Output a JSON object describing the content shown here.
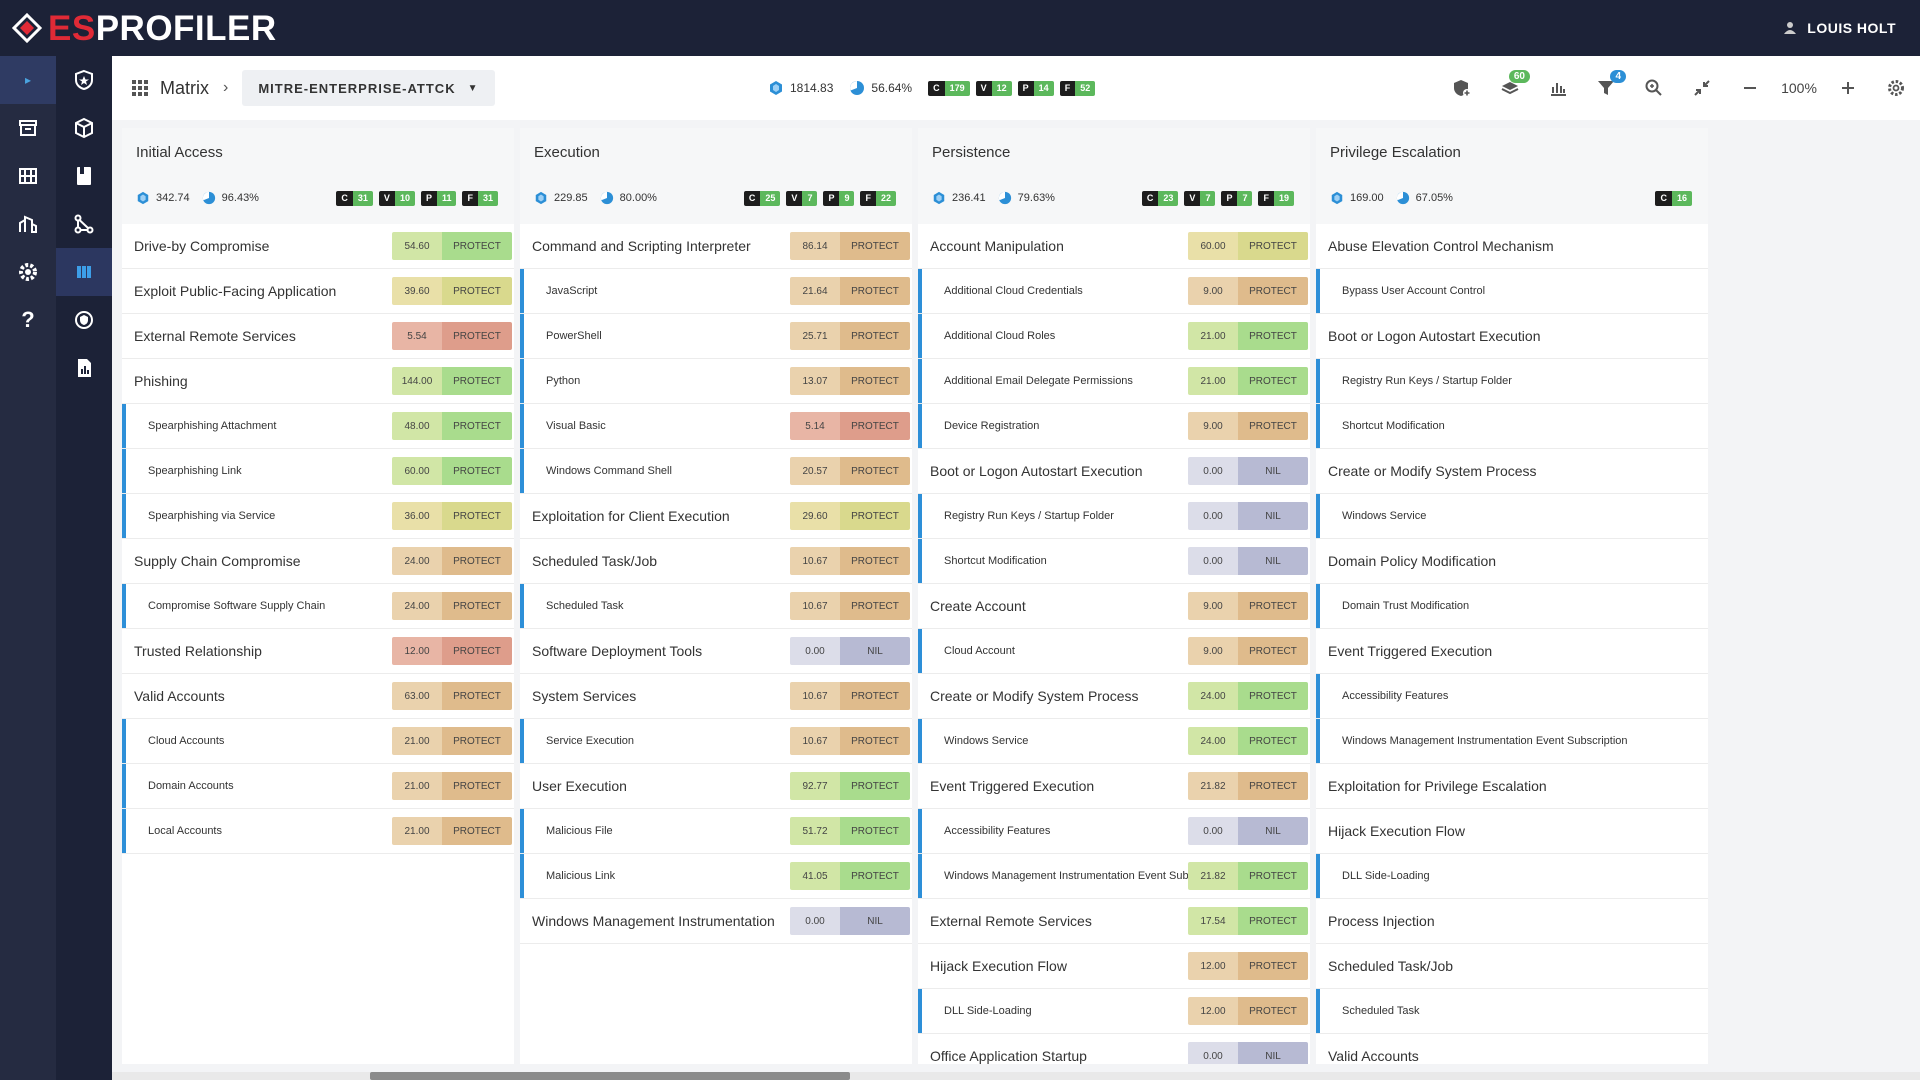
{
  "app": {
    "brand_es": "ES",
    "brand_rest": "PROFILER",
    "user": "LOUIS HOLT"
  },
  "toolbar": {
    "crumb": "Matrix",
    "dropdown": "MITRE-ENTERPRISE-ATTCK",
    "score": "1814.83",
    "pct": "56.64%",
    "badges": [
      {
        "k": "C",
        "v": "179"
      },
      {
        "k": "V",
        "v": "12"
      },
      {
        "k": "P",
        "v": "14"
      },
      {
        "k": "F",
        "v": "52"
      }
    ],
    "filter_count": "60",
    "funnel_count": "4",
    "zoom": "100%"
  },
  "columns": [
    {
      "title": "Initial Access",
      "score": "342.74",
      "pct": "96.43%",
      "badges": [
        {
          "k": "C",
          "v": "31"
        },
        {
          "k": "V",
          "v": "10"
        },
        {
          "k": "P",
          "v": "11"
        },
        {
          "k": "F",
          "v": "31"
        }
      ],
      "rows": [
        {
          "name": "Drive-by Compromise",
          "score": "54.60",
          "label": "PROTECT",
          "color": "g",
          "sub": false
        },
        {
          "name": "Exploit Public-Facing Application",
          "score": "39.60",
          "label": "PROTECT",
          "color": "y",
          "sub": false
        },
        {
          "name": "External Remote Services",
          "score": "5.54",
          "label": "PROTECT",
          "color": "r",
          "sub": false
        },
        {
          "name": "Phishing",
          "score": "144.00",
          "label": "PROTECT",
          "color": "g",
          "sub": false
        },
        {
          "name": "Spearphishing Attachment",
          "score": "48.00",
          "label": "PROTECT",
          "color": "g",
          "sub": true
        },
        {
          "name": "Spearphishing Link",
          "score": "60.00",
          "label": "PROTECT",
          "color": "g",
          "sub": true
        },
        {
          "name": "Spearphishing via Service",
          "score": "36.00",
          "label": "PROTECT",
          "color": "y",
          "sub": true
        },
        {
          "name": "Supply Chain Compromise",
          "score": "24.00",
          "label": "PROTECT",
          "color": "o",
          "sub": false
        },
        {
          "name": "Compromise Software Supply Chain",
          "score": "24.00",
          "label": "PROTECT",
          "color": "o",
          "sub": true
        },
        {
          "name": "Trusted Relationship",
          "score": "12.00",
          "label": "PROTECT",
          "color": "r",
          "sub": false
        },
        {
          "name": "Valid Accounts",
          "score": "63.00",
          "label": "PROTECT",
          "color": "o",
          "sub": false
        },
        {
          "name": "Cloud Accounts",
          "score": "21.00",
          "label": "PROTECT",
          "color": "o",
          "sub": true
        },
        {
          "name": "Domain Accounts",
          "score": "21.00",
          "label": "PROTECT",
          "color": "o",
          "sub": true
        },
        {
          "name": "Local Accounts",
          "score": "21.00",
          "label": "PROTECT",
          "color": "o",
          "sub": true
        }
      ]
    },
    {
      "title": "Execution",
      "score": "229.85",
      "pct": "80.00%",
      "badges": [
        {
          "k": "C",
          "v": "25"
        },
        {
          "k": "V",
          "v": "7"
        },
        {
          "k": "P",
          "v": "9"
        },
        {
          "k": "F",
          "v": "22"
        }
      ],
      "rows": [
        {
          "name": "Command and Scripting Interpreter",
          "score": "86.14",
          "label": "PROTECT",
          "color": "o",
          "sub": false
        },
        {
          "name": "JavaScript",
          "score": "21.64",
          "label": "PROTECT",
          "color": "o",
          "sub": true
        },
        {
          "name": "PowerShell",
          "score": "25.71",
          "label": "PROTECT",
          "color": "o",
          "sub": true
        },
        {
          "name": "Python",
          "score": "13.07",
          "label": "PROTECT",
          "color": "o",
          "sub": true
        },
        {
          "name": "Visual Basic",
          "score": "5.14",
          "label": "PROTECT",
          "color": "r",
          "sub": true
        },
        {
          "name": "Windows Command Shell",
          "score": "20.57",
          "label": "PROTECT",
          "color": "o",
          "sub": true
        },
        {
          "name": "Exploitation for Client Execution",
          "score": "29.60",
          "label": "PROTECT",
          "color": "y",
          "sub": false
        },
        {
          "name": "Scheduled Task/Job",
          "score": "10.67",
          "label": "PROTECT",
          "color": "o",
          "sub": false
        },
        {
          "name": "Scheduled Task",
          "score": "10.67",
          "label": "PROTECT",
          "color": "o",
          "sub": true
        },
        {
          "name": "Software Deployment Tools",
          "score": "0.00",
          "label": "NIL",
          "color": "n",
          "sub": false
        },
        {
          "name": "System Services",
          "score": "10.67",
          "label": "PROTECT",
          "color": "o",
          "sub": false
        },
        {
          "name": "Service Execution",
          "score": "10.67",
          "label": "PROTECT",
          "color": "o",
          "sub": true
        },
        {
          "name": "User Execution",
          "score": "92.77",
          "label": "PROTECT",
          "color": "g",
          "sub": false
        },
        {
          "name": "Malicious File",
          "score": "51.72",
          "label": "PROTECT",
          "color": "g",
          "sub": true
        },
        {
          "name": "Malicious Link",
          "score": "41.05",
          "label": "PROTECT",
          "color": "g",
          "sub": true
        },
        {
          "name": "Windows Management Instrumentation",
          "score": "0.00",
          "label": "NIL",
          "color": "n",
          "sub": false
        }
      ]
    },
    {
      "title": "Persistence",
      "score": "236.41",
      "pct": "79.63%",
      "badges": [
        {
          "k": "C",
          "v": "23"
        },
        {
          "k": "V",
          "v": "7"
        },
        {
          "k": "P",
          "v": "7"
        },
        {
          "k": "F",
          "v": "19"
        }
      ],
      "rows": [
        {
          "name": "Account Manipulation",
          "score": "60.00",
          "label": "PROTECT",
          "color": "y",
          "sub": false
        },
        {
          "name": "Additional Cloud Credentials",
          "score": "9.00",
          "label": "PROTECT",
          "color": "o",
          "sub": true
        },
        {
          "name": "Additional Cloud Roles",
          "score": "21.00",
          "label": "PROTECT",
          "color": "g",
          "sub": true
        },
        {
          "name": "Additional Email Delegate Permissions",
          "score": "21.00",
          "label": "PROTECT",
          "color": "g",
          "sub": true
        },
        {
          "name": "Device Registration",
          "score": "9.00",
          "label": "PROTECT",
          "color": "o",
          "sub": true
        },
        {
          "name": "Boot or Logon Autostart Execution",
          "score": "0.00",
          "label": "NIL",
          "color": "n",
          "sub": false
        },
        {
          "name": "Registry Run Keys / Startup Folder",
          "score": "0.00",
          "label": "NIL",
          "color": "n",
          "sub": true
        },
        {
          "name": "Shortcut Modification",
          "score": "0.00",
          "label": "NIL",
          "color": "n",
          "sub": true
        },
        {
          "name": "Create Account",
          "score": "9.00",
          "label": "PROTECT",
          "color": "o",
          "sub": false
        },
        {
          "name": "Cloud Account",
          "score": "9.00",
          "label": "PROTECT",
          "color": "o",
          "sub": true
        },
        {
          "name": "Create or Modify System Process",
          "score": "24.00",
          "label": "PROTECT",
          "color": "g",
          "sub": false
        },
        {
          "name": "Windows Service",
          "score": "24.00",
          "label": "PROTECT",
          "color": "g",
          "sub": true
        },
        {
          "name": "Event Triggered Execution",
          "score": "21.82",
          "label": "PROTECT",
          "color": "o",
          "sub": false
        },
        {
          "name": "Accessibility Features",
          "score": "0.00",
          "label": "NIL",
          "color": "n",
          "sub": true
        },
        {
          "name": "Windows Management Instrumentation Event Subscription",
          "score": "21.82",
          "label": "PROTECT",
          "color": "g",
          "sub": true
        },
        {
          "name": "External Remote Services",
          "score": "17.54",
          "label": "PROTECT",
          "color": "g",
          "sub": false
        },
        {
          "name": "Hijack Execution Flow",
          "score": "12.00",
          "label": "PROTECT",
          "color": "o",
          "sub": false
        },
        {
          "name": "DLL Side-Loading",
          "score": "12.00",
          "label": "PROTECT",
          "color": "o",
          "sub": true
        },
        {
          "name": "Office Application Startup",
          "score": "0.00",
          "label": "NIL",
          "color": "n",
          "sub": false
        }
      ]
    },
    {
      "title": "Privilege Escalation",
      "score": "169.00",
      "pct": "67.05%",
      "badges": [
        {
          "k": "C",
          "v": "16"
        }
      ],
      "rows": [
        {
          "name": "Abuse Elevation Control Mechanism",
          "score": "",
          "label": "",
          "color": "",
          "sub": false
        },
        {
          "name": "Bypass User Account Control",
          "score": "",
          "label": "",
          "color": "",
          "sub": true
        },
        {
          "name": "Boot or Logon Autostart Execution",
          "score": "",
          "label": "",
          "color": "",
          "sub": false
        },
        {
          "name": "Registry Run Keys / Startup Folder",
          "score": "",
          "label": "",
          "color": "",
          "sub": true
        },
        {
          "name": "Shortcut Modification",
          "score": "",
          "label": "",
          "color": "",
          "sub": true
        },
        {
          "name": "Create or Modify System Process",
          "score": "",
          "label": "",
          "color": "",
          "sub": false
        },
        {
          "name": "Windows Service",
          "score": "",
          "label": "",
          "color": "",
          "sub": true
        },
        {
          "name": "Domain Policy Modification",
          "score": "",
          "label": "",
          "color": "",
          "sub": false
        },
        {
          "name": "Domain Trust Modification",
          "score": "",
          "label": "",
          "color": "",
          "sub": true
        },
        {
          "name": "Event Triggered Execution",
          "score": "",
          "label": "",
          "color": "",
          "sub": false
        },
        {
          "name": "Accessibility Features",
          "score": "",
          "label": "",
          "color": "",
          "sub": true
        },
        {
          "name": "Windows Management Instrumentation Event Subscription",
          "score": "",
          "label": "",
          "color": "",
          "sub": true
        },
        {
          "name": "Exploitation for Privilege Escalation",
          "score": "",
          "label": "",
          "color": "",
          "sub": false
        },
        {
          "name": "Hijack Execution Flow",
          "score": "",
          "label": "",
          "color": "",
          "sub": false
        },
        {
          "name": "DLL Side-Loading",
          "score": "",
          "label": "",
          "color": "",
          "sub": true
        },
        {
          "name": "Process Injection",
          "score": "",
          "label": "",
          "color": "",
          "sub": false
        },
        {
          "name": "Scheduled Task/Job",
          "score": "",
          "label": "",
          "color": "",
          "sub": false
        },
        {
          "name": "Scheduled Task",
          "score": "",
          "label": "",
          "color": "",
          "sub": true
        },
        {
          "name": "Valid Accounts",
          "score": "",
          "label": "",
          "color": "",
          "sub": false
        }
      ]
    }
  ]
}
